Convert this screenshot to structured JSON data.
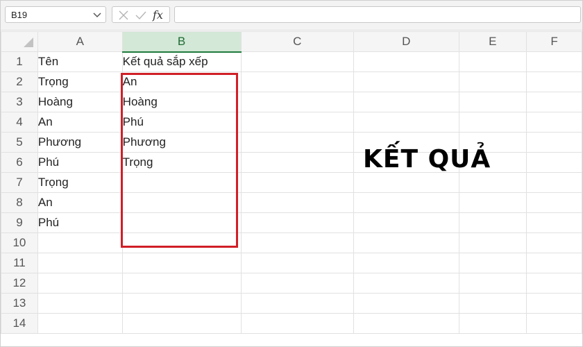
{
  "name_box": {
    "value": "B19"
  },
  "formula_bar": {
    "fx_label": "fx",
    "content": ""
  },
  "columns": [
    "A",
    "B",
    "C",
    "D",
    "E",
    "F"
  ],
  "selected_column": "B",
  "rows": [
    {
      "num": "1",
      "A": "Tên",
      "B": "Kết quả sắp xếp"
    },
    {
      "num": "2",
      "A": "Trọng",
      "B": "An"
    },
    {
      "num": "3",
      "A": "Hoàng",
      "B": "Hoàng"
    },
    {
      "num": "4",
      "A": "An",
      "B": "Phú"
    },
    {
      "num": "5",
      "A": "Phương",
      "B": "Phương"
    },
    {
      "num": "6",
      "A": "Phú",
      "B": "Trọng"
    },
    {
      "num": "7",
      "A": "Trọng",
      "B": ""
    },
    {
      "num": "8",
      "A": "An",
      "B": ""
    },
    {
      "num": "9",
      "A": "Phú",
      "B": ""
    },
    {
      "num": "10",
      "A": "",
      "B": ""
    },
    {
      "num": "11",
      "A": "",
      "B": ""
    },
    {
      "num": "12",
      "A": "",
      "B": ""
    },
    {
      "num": "13",
      "A": "",
      "B": ""
    },
    {
      "num": "14",
      "A": "",
      "B": ""
    }
  ],
  "annotation": {
    "text": "KẾT QUẢ",
    "box_color": "#d11f26"
  }
}
